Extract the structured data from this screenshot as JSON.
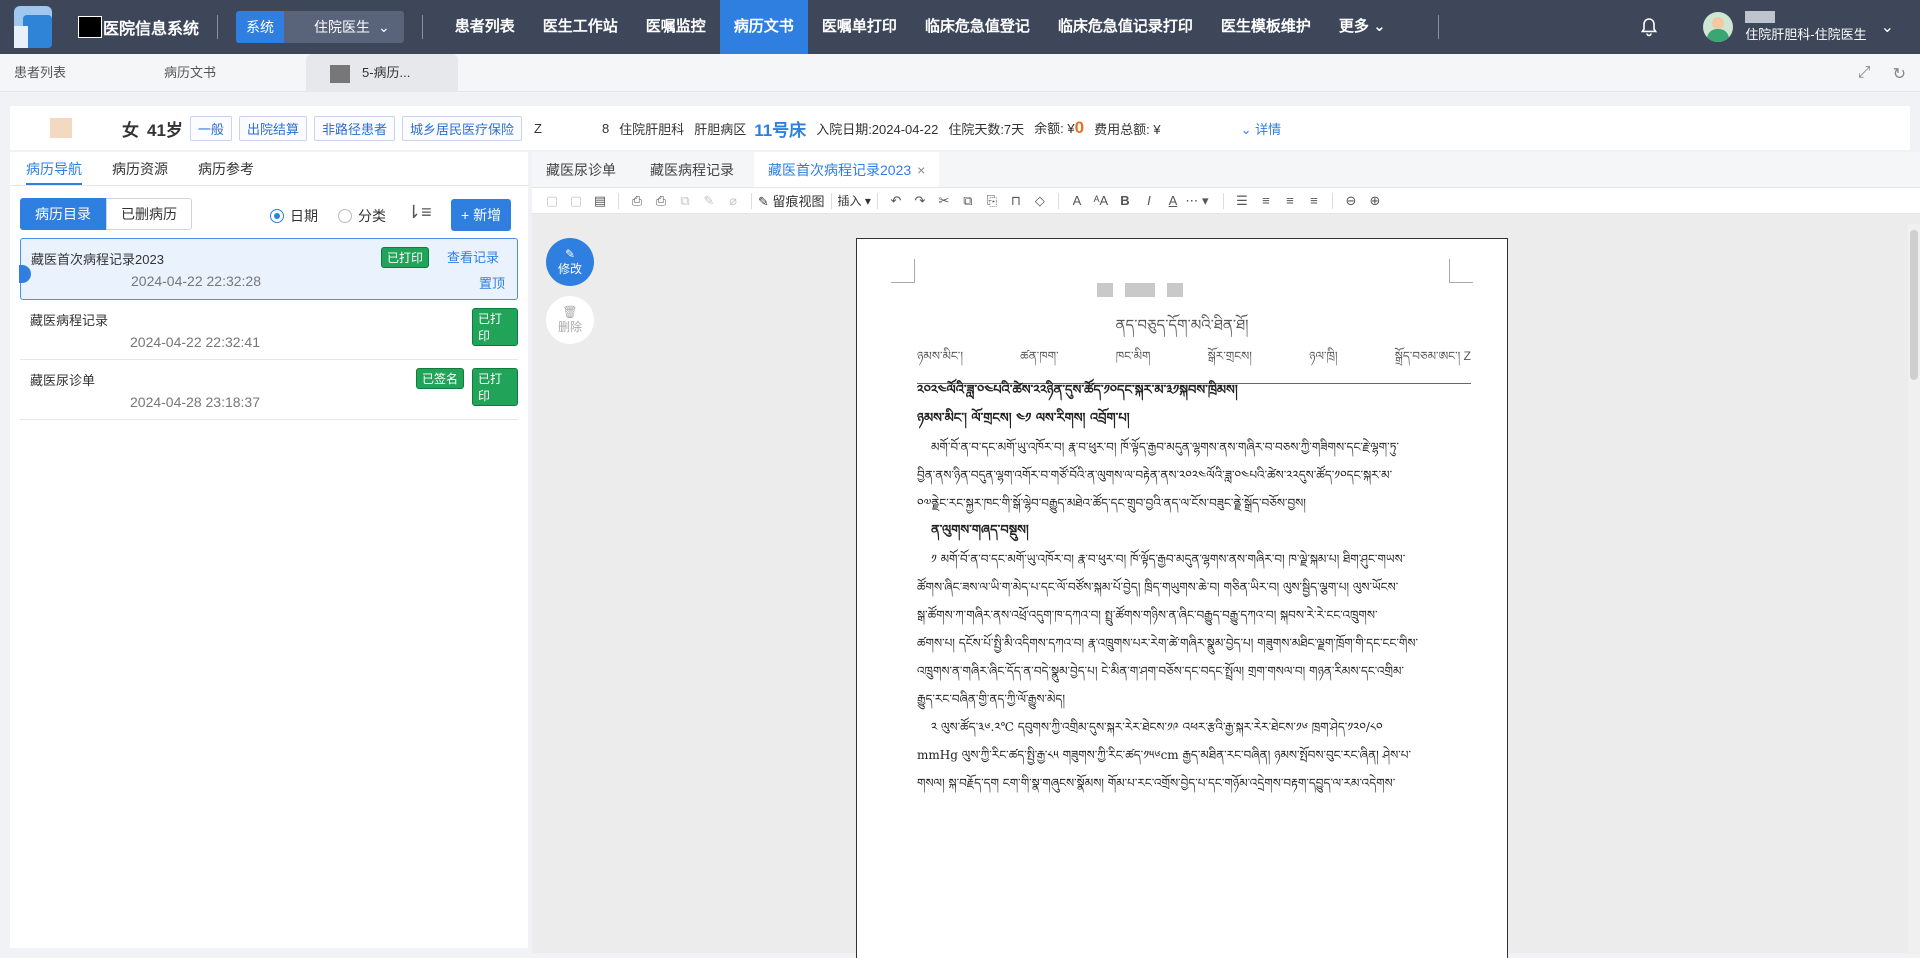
{
  "app": {
    "title": "医院信息系统",
    "system_label": "系统",
    "role": "住院医生"
  },
  "nav": [
    "患者列表",
    "医生工作站",
    "医嘱监控",
    "病历文书",
    "医嘱单打印",
    "临床危急值登记",
    "临床危急值记录打印",
    "医生模板维护",
    "更多"
  ],
  "nav_active": "病历文书",
  "user": {
    "dept": "住院肝胆科-住院医生"
  },
  "page_tabs": [
    "患者列表",
    "病历文书",
    "5-病历..."
  ],
  "patient": {
    "sex": "女",
    "age": "41岁",
    "tags": [
      "一般",
      "出院结算",
      "非路径患者",
      "城乡居民医疗保险"
    ],
    "code": "Z",
    "num": "8",
    "dept": "住院肝胆科",
    "ward": "肝胆病区",
    "bed": "11号床",
    "admit": "入院日期:2024-04-22",
    "days": "住院天数:7天",
    "balance_label": "余额: ¥",
    "balance": "0",
    "cost": "费用总额: ¥",
    "detail": "详情"
  },
  "left": {
    "tabs": [
      "病历导航",
      "病历资源",
      "病历参考"
    ],
    "seg": [
      "病历目录",
      "已删病历"
    ],
    "radios": [
      "日期",
      "分类"
    ],
    "new_btn": "+ 新增",
    "records": [
      {
        "title": "藏医首次病程记录2023",
        "time": "2024-04-22 22:32:28",
        "badges": [
          "已打印"
        ],
        "links": [
          "查看记录",
          "置顶"
        ]
      },
      {
        "title": "藏医病程记录",
        "time": "2024-04-22 22:32:41",
        "badges": [
          "已打印"
        ]
      },
      {
        "title": "藏医尿诊单",
        "time": "2024-04-28 23:18:37",
        "badges": [
          "已签名",
          "已打印"
        ]
      }
    ]
  },
  "doc": {
    "tabs": [
      "藏医尿诊单",
      "藏医病程记录",
      "藏医首次病程记录2023"
    ],
    "trace_view": "留痕视图",
    "insert": "插入",
    "edit": "修改",
    "delete": "删除",
    "title": "ནད་བཅུད་དོག་མའི་ཐིན་ཐོ།",
    "header": [
      "ཉམས་མིང་། ",
      "ཚན་ཁག་",
      "ཁང་མིག ",
      "སྒོར་གྲངས།",
      "ཉལ་ཁྲི། ",
      "སྒྲོད་བཅམ་ཨང་། Z"
    ],
    "lines": [
      "༢༠༢༤ལོའི་ཟླ་༠༤པའི་ཚེས་༢༢ཉིན་དུས་ཚོད་༡༠དང་སྐར་མ་༣༡སྐབས་ཁྲིམས།",
      "ཉམས་མིང་། ལོ་གྲངས། ༤༡ ལས་རིགས། འབྲོག་པ།",
      "མགོ་བོ་ན་བ་དང་མགོ་ཡུ་འཁོར་བ། རྣ་བ་ཕུར་བ། ཁོ་ལྟོད་རྒྱབ་མདུན་ལྷགས་ནས་གཞིར་བ་བཅས་ཀྱི་གཟིགས་དང་རྗེ་ལྷག་ཏུ་",
      "བྱིན་ནས་ཉིན་བདུན་ལྷག་འགོར་བ་གཙོ་བོའི་ན་ལུགས་ལ་བརྟེན་ནས་༢༠༢༤ལོའི་ཟླ་༠༤པའི་ཚེས་༢༢དུས་ཚོད་༡༠དང་སྐར་མ་",
      "༠༧ནྗེང་རང་སྐྱར་ཁང་གི་སྒོ་ལྷེབ་བརྒྱུད་མཐེའ་ཚོད་དང་གྲུབ་བྱའི་ནད་ལ་ངོས་བཟུང་ནྗེ་སྒྲོད་བཅོས་བྱས།",
      "ན་ལུགས་གཞད་བསྡུས།",
      "༡ མགོ་བོ་ན་བ་དང་མགོ་ཡུ་འཁོར་བ། རྣ་བ་ཕུར་བ། ཁོ་ལྟོད་རྒྱབ་མདུན་ལྷགས་ནས་གཞིར་བ། ཁ་ལྗེ་སྐམ་པ། ཐིག་ཤུང་གཡས་",
      "ཚོགས་ཞིང་ཟས་ལ་ཡི་ག་མེད་པ་དང་ལོ་བཙོས་སྐམ་པོ་བྱེད། ཁྲིད་གཡུགས་ཆེ་བ། གཅིན་ཡིར་བ། ལུས་སྦྱིད་ལྕག་པ། ལུས་ཡོངས་",
      "སྒ་ཚོགས་ཀ་གཞིར་ནས་འཕྲོ་འདུག་ཁ་དཀའ་བ། སྤྲུ་ཚོགས་གཉིས་ན་ཞིང་བརྒྱུད་བརྒྱུ་དཀའ་བ། སྐབས་རེ་རེ་ངང་འཁྲུགས་",
      "ཚགས་པ། དངོས་པོ་སྤྱི་མི་འདིགས་དཀའ་བ། རྣ་འཁྲུགས་པར་རེག་ཚེ་གཞིར་སྣུམ་བྱེད་པ། གཟུགས་མཐིང་ལྗག་ཁྲོག་གི་དང་ངང་གིས་",
      "འཁྲུགས་ན་གཞིར་ཞིང་དོད་ན་བདེ་སྣུམ་བྱེད་པ། ངེ་མིན་ག་ཤག་བཅོས་དང་བདང་སྤྲོལ། གྲག་གསལ་བ། གཉན་རིམས་དང་འགྲིམ་",
      "རྒྱུད་རང་བཞིན་གྱི་ནད་ཀྱི་ལོ་རྒྱུས་མེད།",
      "༢ ལུས་ཚོད་༣༦.༢℃ དབུགས་ཀྱི་འགྲིམ་དུས་སྐར་རེར་ཐེངས་༡༩ འཕར་རྩའི་རྒྱ་སྐར་རེར་ཐེངས་༡༦ ཁྲག་ཤེད་༡༢༠/༨༠",
      "mmHg ལུས་ཀྱི་རིང་ཚད་སྤྱི་རྒྱ་༨༥ གཟུགས་ཀྱི་རིང་ཚད་༡༥༦cm རྒྱད་མཐིན་རང་བཞིན། ཉམས་སྤོབས་བུང་རང་ཞིན། ཤེས་པ་",
      "གསལ། སྐ་བརྗོད་དག ངག་གི་སྣ་གཞུངས་སྣོམས། གོམ་པ་རང་འགྲོས་བྱེད་པ་དང་གཉོམ་འདྲེགས་བརྟག་དབྱུད་ལ་རམ་འདེགས་"
    ]
  }
}
